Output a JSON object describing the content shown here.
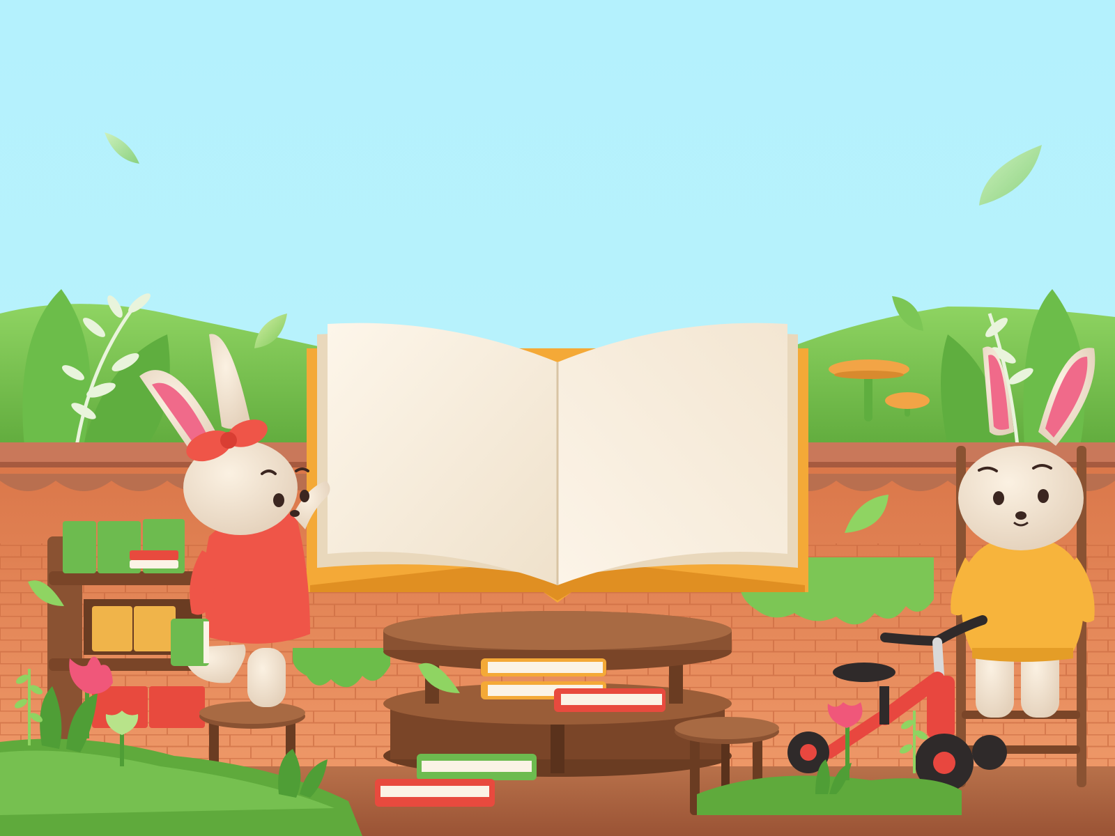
{
  "scene": {
    "description_tag": "3d-illustration",
    "colors": {
      "sky": "#b4f1fd",
      "grass": "#7cc653",
      "grass_dark": "#4f9e36",
      "wall_brick": "#e88a5a",
      "wall_cap": "#c9785a",
      "floor": "#a9603f",
      "book_page": "#fbf3e6",
      "book_cover": "#f4a937",
      "rabbit_fur": "#f3e6d5",
      "rabbit_ear_inner": "#f06a8a",
      "dress_red": "#ef5548",
      "sweater_yellow": "#f7b43c",
      "wood": "#8a5232",
      "book_green": "#6dbb4f",
      "book_red": "#e84a3e",
      "tricycle_red": "#e8473f",
      "flower_pink": "#f0577a",
      "mushroom_orange": "#f2a446"
    },
    "open_book": {
      "left_page_text": "",
      "right_page_text": ""
    },
    "icons": [
      "leaf-icon",
      "flower-icon",
      "mushroom-icon",
      "book-icon",
      "rabbit-icon",
      "tricycle-icon",
      "stool-icon",
      "shelf-icon"
    ]
  }
}
